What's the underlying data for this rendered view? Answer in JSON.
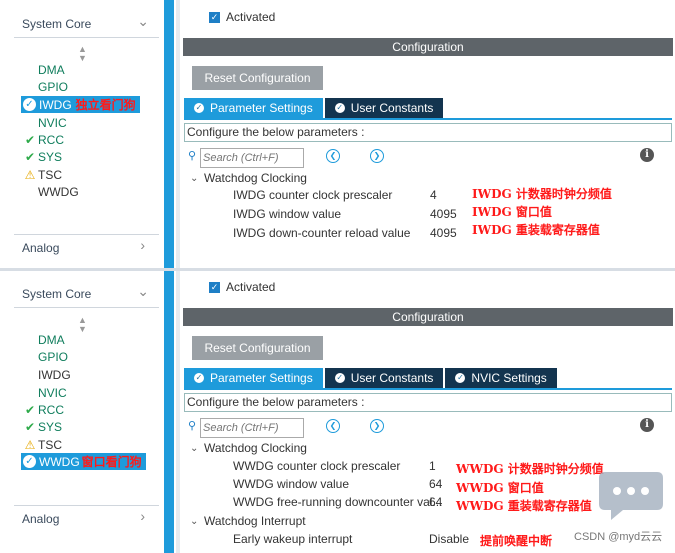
{
  "panels": [
    {
      "sidebar": {
        "title": "System Core",
        "items": [
          {
            "label": "DMA",
            "status": "none"
          },
          {
            "label": "GPIO",
            "status": "none"
          },
          {
            "label": "IWDG",
            "status": "selected",
            "annotation": "独立看门狗"
          },
          {
            "label": "NVIC",
            "status": "none"
          },
          {
            "label": "RCC",
            "status": "ok"
          },
          {
            "label": "SYS",
            "status": "ok"
          },
          {
            "label": "TSC",
            "status": "warn"
          },
          {
            "label": "WWDG",
            "status": "plain"
          }
        ],
        "footer": "Analog"
      },
      "activated_label": "Activated",
      "config_header": "Configuration",
      "reset_label": "Reset Configuration",
      "tabs": [
        "Parameter Settings",
        "User Constants"
      ],
      "hint": "Configure the below parameters :",
      "search_placeholder": "Search (Ctrl+F)",
      "groups": [
        {
          "name": "Watchdog Clocking",
          "params": [
            {
              "name": "IWDG counter clock prescaler",
              "value": "4",
              "annotation": "IWDG 计数器时钟分频值"
            },
            {
              "name": "IWDG window value",
              "value": "4095",
              "annotation": "IWDG 窗口值"
            },
            {
              "name": "IWDG down-counter reload value",
              "value": "4095",
              "annotation": "IWDG 重装载寄存器值"
            }
          ]
        }
      ]
    },
    {
      "sidebar": {
        "title": "System Core",
        "items": [
          {
            "label": "DMA",
            "status": "none"
          },
          {
            "label": "GPIO",
            "status": "none"
          },
          {
            "label": "IWDG",
            "status": "plain"
          },
          {
            "label": "NVIC",
            "status": "none"
          },
          {
            "label": "RCC",
            "status": "ok"
          },
          {
            "label": "SYS",
            "status": "ok"
          },
          {
            "label": "TSC",
            "status": "warn"
          },
          {
            "label": "WWDG",
            "status": "selected",
            "annotation": "窗口看门狗"
          }
        ],
        "footer": "Analog"
      },
      "activated_label": "Activated",
      "config_header": "Configuration",
      "reset_label": "Reset Configuration",
      "tabs": [
        "Parameter Settings",
        "User Constants",
        "NVIC Settings"
      ],
      "hint": "Configure the below parameters :",
      "search_placeholder": "Search (Ctrl+F)",
      "groups": [
        {
          "name": "Watchdog Clocking",
          "params": [
            {
              "name": "WWDG counter clock prescaler",
              "value": "1",
              "annotation": "WWDG 计数器时钟分频值"
            },
            {
              "name": "WWDG window value",
              "value": "64",
              "annotation": "WWDG 窗口值"
            },
            {
              "name": "WWDG free-running downcounter val...",
              "value": "64",
              "annotation": "WWDG 重装载寄存器值"
            }
          ]
        },
        {
          "name": "Watchdog Interrupt",
          "params": [
            {
              "name": "Early wakeup interrupt",
              "value": "Disable",
              "annotation": "提前唤醒中断"
            }
          ]
        }
      ]
    }
  ],
  "watermark": "CSDN @myd云云",
  "icons": {
    "ok": "check-icon",
    "warn": "warning-icon",
    "search": "search-icon",
    "info": "info-icon",
    "chat": "chat-bubble-icon"
  },
  "colors": {
    "accent": "#1e9bdb",
    "dark_tab": "#13344f",
    "header_gray": "#5e6469",
    "annotation_red": "#ff1a1a",
    "ok_green": "#2eaa4a"
  }
}
